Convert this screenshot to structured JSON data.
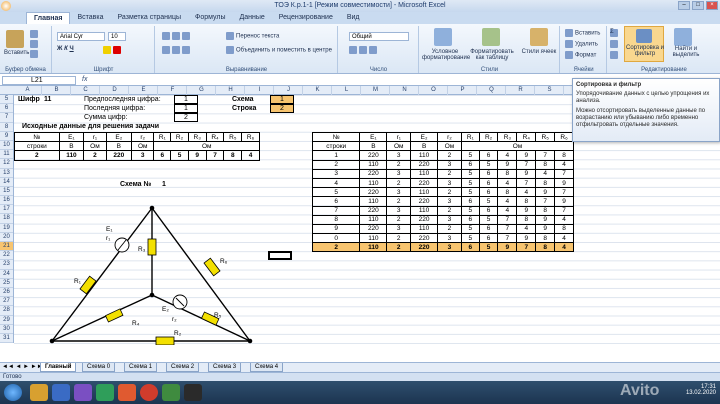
{
  "window": {
    "title": "ТОЭ К.р.1-1  [Режим совместимости] - Microsoft Excel"
  },
  "tabs": [
    "Главная",
    "Вставка",
    "Разметка страницы",
    "Формулы",
    "Данные",
    "Рецензирование",
    "Вид"
  ],
  "ribbon": {
    "paste": "Вставить",
    "clipboard": "Буфер обмена",
    "font": "Шрифт",
    "font_name": "Arial Cyr",
    "font_size": "10",
    "alignment": "Выравнивание",
    "wrap": "Перенос текста",
    "merge": "Объединить и поместить в центре",
    "number": "Число",
    "number_format": "Общий",
    "styles": "Стили",
    "cond": "Условное форматирование",
    "fmt_table": "Форматировать как таблицу",
    "cell_styles": "Стили ячеек",
    "cells": "Ячейки",
    "insert": "Вставить",
    "delete": "Удалить",
    "format": "Формат",
    "editing": "Редактирование",
    "sort": "Сортировка и фильтр",
    "find": "Найти и выделить"
  },
  "namebox": "L21",
  "fx": "fx",
  "columns": [
    "A",
    "B",
    "C",
    "D",
    "E",
    "F",
    "G",
    "H",
    "I",
    "J",
    "K",
    "L",
    "M",
    "N",
    "O",
    "P",
    "Q",
    "R",
    "S",
    "T",
    "U",
    "V",
    "W",
    "X"
  ],
  "rows": [
    "5",
    "6",
    "7",
    "8",
    "9",
    "10",
    "11",
    "12",
    "13",
    "14",
    "15",
    "16",
    "17",
    "18",
    "19",
    "20",
    "21",
    "22",
    "23",
    "24",
    "25",
    "26",
    "27",
    "28",
    "29",
    "30",
    "31"
  ],
  "cells": {
    "shifr": "Шифр",
    "shifr_val": "11",
    "pred": "Предпоследняя цифра:",
    "pred_val": "1",
    "last": "Последняя цифра:",
    "last_val": "1",
    "sum": "Сумма цифр:",
    "sum_val": "2",
    "schema": "Схема",
    "schema_val": "1",
    "stroka": "Строка",
    "stroka_val": "2",
    "source": "Исходные данные для решения задачи",
    "scheme_title": "Схема №",
    "scheme_num": "1"
  },
  "left_table": {
    "h1": [
      "№",
      "E₁",
      "r₁",
      "E₂",
      "r₂",
      "R₁",
      "R₂",
      "R₃",
      "R₄",
      "R₅",
      "R₆"
    ],
    "h2": [
      "строки",
      "В",
      "Ом",
      "В",
      "Ом",
      "Ом"
    ],
    "row": [
      "2",
      "110",
      "2",
      "220",
      "3",
      "6",
      "5",
      "9",
      "7",
      "8",
      "4"
    ]
  },
  "right_table": {
    "h1": [
      "№",
      "E₁",
      "r₁",
      "E₂",
      "r₂",
      "R₁",
      "R₂",
      "R₃",
      "R₄",
      "R₅",
      "R₆"
    ],
    "h2": [
      "строки",
      "В",
      "Ом",
      "В",
      "Ом",
      "Ом"
    ],
    "rows": [
      [
        "1",
        "220",
        "3",
        "110",
        "2",
        "5",
        "6",
        "4",
        "9",
        "7",
        "8"
      ],
      [
        "2",
        "110",
        "2",
        "220",
        "3",
        "6",
        "5",
        "9",
        "7",
        "8",
        "4"
      ],
      [
        "3",
        "220",
        "3",
        "110",
        "2",
        "5",
        "6",
        "8",
        "9",
        "4",
        "7"
      ],
      [
        "4",
        "110",
        "2",
        "220",
        "3",
        "5",
        "6",
        "4",
        "7",
        "8",
        "9"
      ],
      [
        "5",
        "220",
        "3",
        "110",
        "2",
        "5",
        "6",
        "8",
        "4",
        "9",
        "7"
      ],
      [
        "6",
        "110",
        "2",
        "220",
        "3",
        "6",
        "5",
        "4",
        "8",
        "7",
        "9"
      ],
      [
        "7",
        "220",
        "3",
        "110",
        "2",
        "5",
        "6",
        "4",
        "9",
        "8",
        "7"
      ],
      [
        "8",
        "110",
        "2",
        "220",
        "3",
        "6",
        "5",
        "7",
        "8",
        "9",
        "4"
      ],
      [
        "9",
        "220",
        "3",
        "110",
        "2",
        "5",
        "6",
        "7",
        "4",
        "9",
        "8"
      ],
      [
        "0",
        "110",
        "2",
        "220",
        "3",
        "5",
        "6",
        "7",
        "9",
        "8",
        "4"
      ],
      [
        "2",
        "110",
        "2",
        "220",
        "3",
        "6",
        "5",
        "9",
        "7",
        "8",
        "4"
      ]
    ]
  },
  "schematic": {
    "e1": "E₁",
    "r1": "r₁",
    "e2": "E₂",
    "r2": "r₂",
    "R1": "R₁",
    "R2": "R₂",
    "R3": "R₃",
    "R4": "R₄",
    "R5": "R₅",
    "R6": "R₆"
  },
  "tooltip": {
    "title": "Сортировка и фильтр",
    "p1": "Упорядочивание данных с целью упрощения их анализа.",
    "p2": "Можно отсортировать выделенные данные по возрастанию или убыванию либо временно отфильтровать отдельные значения."
  },
  "sheets": [
    "Главный",
    "Схема 0",
    "Схема 1",
    "Схема 2",
    "Схема 3",
    "Схема 4"
  ],
  "status": "Готово",
  "clock": {
    "time": "17:31",
    "date": "13.02.2020"
  },
  "watermark": "Avito"
}
